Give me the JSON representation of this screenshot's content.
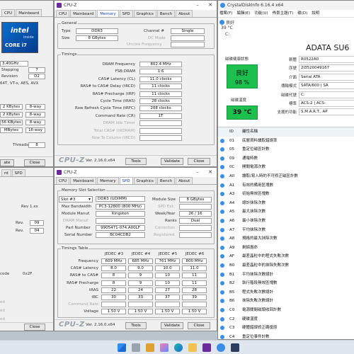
{
  "win_left": {
    "tabs": [
      "CPU",
      "Mainboard"
    ],
    "rows": [
      {
        "label": "",
        "value": "3.40GHz"
      },
      {
        "label": "Stepping",
        "value": "7"
      },
      {
        "label": "Revision",
        "value": "D2"
      },
      {
        "label": "",
        "value": "64T, VT-x, AES, AVX"
      }
    ],
    "cache": [
      {
        "a": "2 KBytes",
        "b": "8-way"
      },
      {
        "a": "2 KBytes",
        "b": "8-way"
      },
      {
        "a": "56 KBytes",
        "b": "8-way"
      },
      {
        "a": "MBytes",
        "b": "16-way"
      }
    ],
    "threads_label": "Threads",
    "threads": "8",
    "validate": "ate",
    "close": "Close",
    "logo_inside": "inside",
    "logo_core": "CORE i7",
    "logo_intel": "intel"
  },
  "win_left2": {
    "tabs": [
      "rd",
      "SPD"
    ],
    "rev": "Rev 1.xx",
    "rows": [
      {
        "label": "Rev.",
        "value": "09"
      },
      {
        "label": "Rev.",
        "value": "04"
      }
    ],
    "code_label": "code",
    "code": "0x2F",
    "close": "Close",
    "side1": "ed",
    "side2": "ed",
    "side3": "ed"
  },
  "cpuz_mem": {
    "title": "CPU-Z",
    "tabs": [
      "CPU",
      "Mainboard",
      "Memory",
      "SPD",
      "Graphics",
      "Bench",
      "About"
    ],
    "active_tab": "Memory",
    "general": "General",
    "type_label": "Type",
    "type": "DDR3",
    "channel_label": "Channel #",
    "channel": "Single",
    "size_label": "Size",
    "size": "8 GBytes",
    "dcmode_label": "DC Mode",
    "uncore_label": "Uncore Frequency",
    "timings": "Timings",
    "rows": [
      {
        "label": "DRAM Frequency",
        "value": "802.4 MHz",
        "dim": false
      },
      {
        "label": "FSB:DRAM",
        "value": "1:6",
        "dim": false
      },
      {
        "label": "CAS# Latency (CL)",
        "value": "11.0 clocks",
        "dim": false
      },
      {
        "label": "RAS# to CAS# Delay (tRCD)",
        "value": "11 clocks",
        "dim": false
      },
      {
        "label": "RAS# Precharge (tRP)",
        "value": "11 clocks",
        "dim": false
      },
      {
        "label": "Cycle Time (tRAS)",
        "value": "28 clocks",
        "dim": false
      },
      {
        "label": "Row Refresh Cycle Time (tRFC)",
        "value": "208 clocks",
        "dim": false
      },
      {
        "label": "Command Rate (CR)",
        "value": "1T",
        "dim": false
      },
      {
        "label": "DRAM Idle Timer",
        "value": "",
        "dim": true
      },
      {
        "label": "Total CAS# (tRDRAM)",
        "value": "",
        "dim": true
      },
      {
        "label": "Row To Column (tRCD)",
        "value": "",
        "dim": true
      }
    ],
    "logo": "CPU-Z",
    "version": "Ver. 2.16.0.x64",
    "tools": "Tools",
    "validate": "Validate",
    "close": "Close"
  },
  "cpuz_spd": {
    "title": "CPU-Z",
    "tabs": [
      "CPU",
      "Mainboard",
      "Memory",
      "SPD",
      "Graphics",
      "Bench",
      "About"
    ],
    "active_tab": "SPD",
    "slot_group": "Memory Slot Selection",
    "slot": "Slot #3",
    "slot_type": "DDR3 (UDIMM)",
    "module_size_label": "Module Size",
    "module_size": "8 GBytes",
    "max_bw_label": "Max Bandwidth",
    "max_bw": "PC3-12800 (800 MHz)",
    "spd_ext_label": "SPD Ext.",
    "manuf_label": "Module Manuf.",
    "manuf": "Kingston",
    "week_label": "Week/Year",
    "week": "26 / 16",
    "dram_label": "DRAM Manuf.",
    "ranks_label": "Ranks",
    "ranks": "Dual",
    "part_label": "Part Number",
    "part": "9905471-074.A00LF",
    "corr_label": "Correction",
    "serial_label": "Serial Number",
    "serial": "BC04CDB2",
    "reg_label": "Registered",
    "timings": "Timings Table",
    "jedec": [
      "JEDEC #3",
      "JEDEC #4",
      "JEDEC #5",
      "JEDEC #6"
    ],
    "trows": [
      {
        "label": "Frequency",
        "v": [
          "609 MHz",
          "685 MHz",
          "761 MHz",
          "800 MHz"
        ],
        "dim": false
      },
      {
        "label": "CAS# Latency",
        "v": [
          "8.0",
          "9.0",
          "10.0",
          "11.0"
        ],
        "dim": false
      },
      {
        "label": "RAS# to CAS#",
        "v": [
          "8",
          "9",
          "10",
          "11"
        ],
        "dim": false
      },
      {
        "label": "RAS# Precharge",
        "v": [
          "8",
          "9",
          "10",
          "11"
        ],
        "dim": false
      },
      {
        "label": "tRAS",
        "v": [
          "22",
          "24",
          "27",
          "28"
        ],
        "dim": false
      },
      {
        "label": "tRC",
        "v": [
          "30",
          "33",
          "37",
          "39"
        ],
        "dim": false
      },
      {
        "label": "Command Rate",
        "v": [
          "",
          "",
          "",
          ""
        ],
        "dim": true
      },
      {
        "label": "Voltage",
        "v": [
          "1.50 V",
          "1.50 V",
          "1.50 V",
          "1.50 V"
        ],
        "dim": false
      }
    ],
    "logo": "CPU-Z",
    "version": "Ver. 2.16.0.x64",
    "tools": "Tools",
    "validate": "Validate",
    "close": "Close"
  },
  "cdi": {
    "title": "CrystalDiskInfo 6.16.4 x64",
    "menu": [
      "檔案(F)",
      "編輯(E)",
      "功能(U)",
      "佈景主題(T)",
      "碟(D)",
      "說明"
    ],
    "disk_status": "良好",
    "disk_temp": "39 °C",
    "disk_letter": "C:",
    "model": "ADATA SU6",
    "health_label": "磁碟健康狀態",
    "health_word": "良好",
    "health_pct": "98 %",
    "temp_label": "磁碟溫度",
    "temp": "39 °C",
    "info": [
      {
        "label": "韌體",
        "value": "R0522A0"
      },
      {
        "label": "序號",
        "value": "2I3520049167"
      },
      {
        "label": "介面",
        "value": "Serial ATA"
      },
      {
        "label": "傳輸模式",
        "value": "SATA/600 | SA"
      },
      {
        "label": "磁碟代號",
        "value": "C:"
      },
      {
        "label": "標準",
        "value": "ACS-2 | ACS-"
      },
      {
        "label": "支援的功能",
        "value": "S.M.A.R.T., AP"
      }
    ],
    "col_id": "ID",
    "col_name": "屬性名稱",
    "smart": [
      {
        "id": "01",
        "name": "底層資料讀取錯誤率"
      },
      {
        "id": "05",
        "name": "重定位磁區計數"
      },
      {
        "id": "09",
        "name": "通電時數"
      },
      {
        "id": "0C",
        "name": "開關電源次數"
      },
      {
        "id": "A0",
        "name": "讀取/寫入時的不可修正磁區計數"
      },
      {
        "id": "A1",
        "name": "有效的備用區塊數"
      },
      {
        "id": "A3",
        "name": "初始無效區塊數"
      },
      {
        "id": "A4",
        "name": "總計抹除次數"
      },
      {
        "id": "A5",
        "name": "最大抹除次數"
      },
      {
        "id": "A6",
        "name": "最小抹除次數"
      },
      {
        "id": "A7",
        "name": "平均抹除次數"
      },
      {
        "id": "A8",
        "name": "規格的最大抹除次數"
      },
      {
        "id": "A9",
        "name": "剩餘壽命"
      },
      {
        "id": "AF",
        "name": "最差晶粒中的程式失敗次數"
      },
      {
        "id": "B0",
        "name": "最差晶粒中的抹除失敗次數"
      },
      {
        "id": "B1",
        "name": "平均抹除次數總計"
      },
      {
        "id": "B2",
        "name": "執行階段無效區塊數"
      },
      {
        "id": "B5",
        "name": "程式失敗次數總計"
      },
      {
        "id": "B6",
        "name": "抹除失敗次數總計"
      },
      {
        "id": "C0",
        "name": "電源關閉磁頭收回計數"
      },
      {
        "id": "C2",
        "name": "硬碟溫度"
      },
      {
        "id": "C3",
        "name": "硬體錯誤修正碼復原"
      },
      {
        "id": "C4",
        "name": "重定位事件計數"
      },
      {
        "id": "C5",
        "name": "等候重定的磁區計數"
      },
      {
        "id": "C6",
        "name": "無法校正的磁區計數總計"
      }
    ]
  },
  "colors": {
    "health_green": "#1dbf4f",
    "temp_blue": "#3b8ee8",
    "cpuz_blue": "#1a3a9a"
  }
}
